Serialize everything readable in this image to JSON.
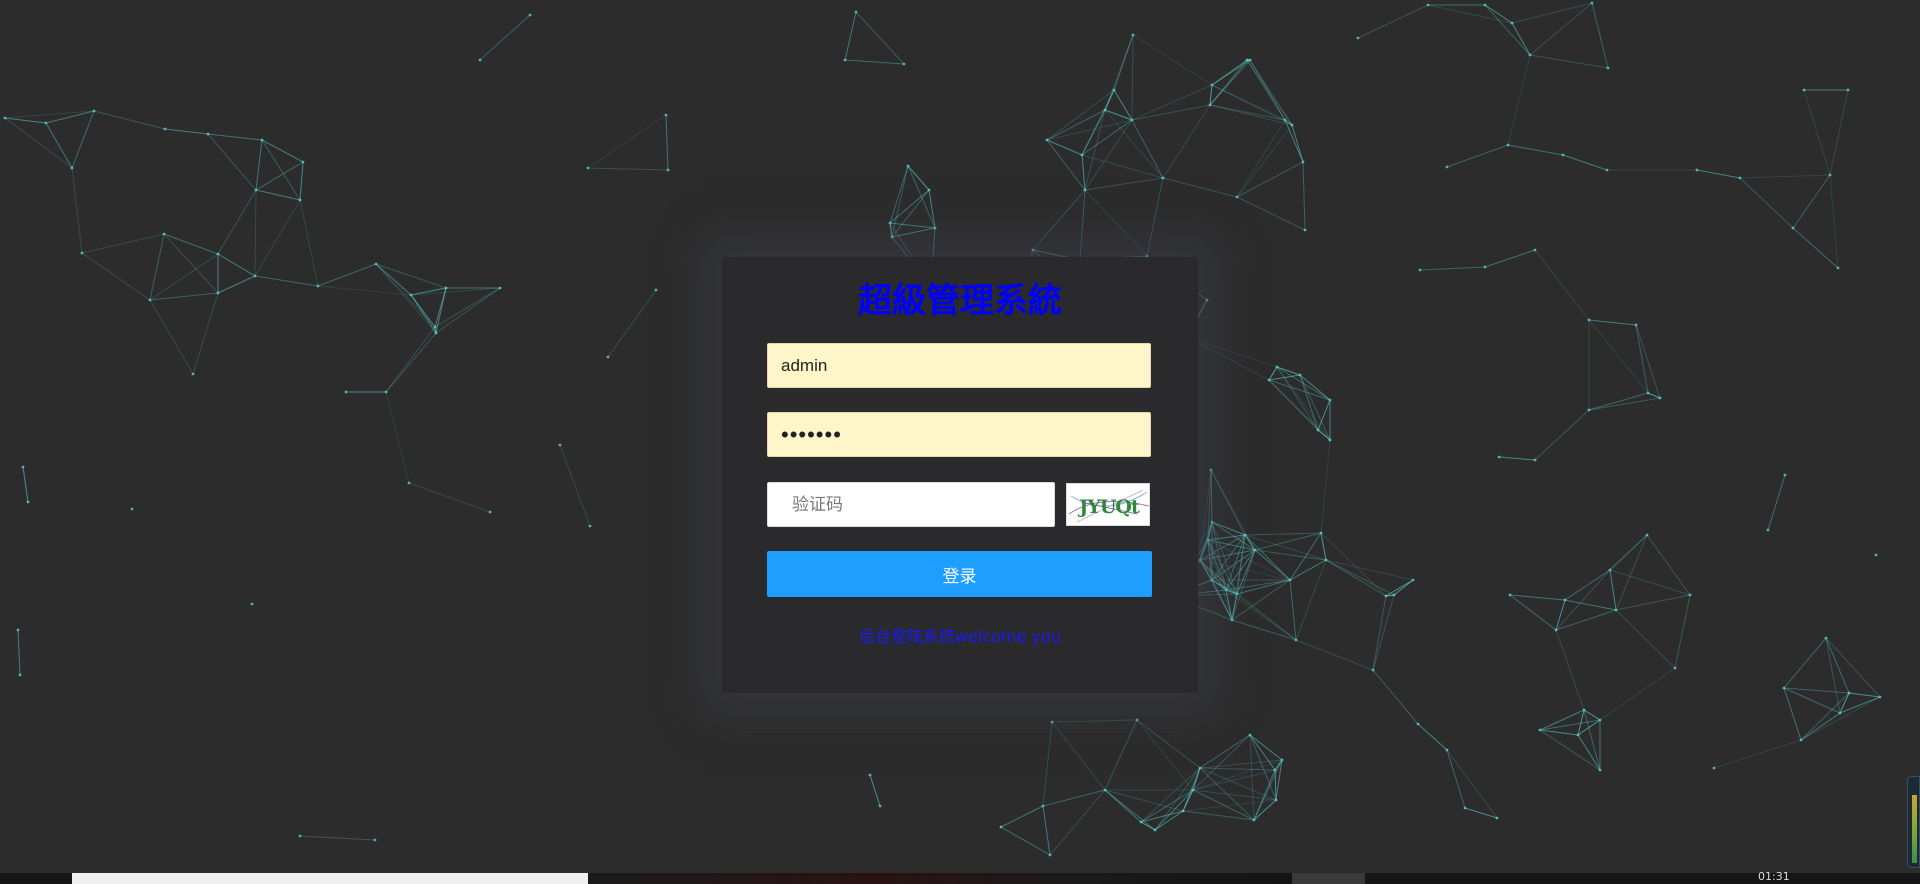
{
  "login": {
    "title": "超級管理系統",
    "username_value": "admin",
    "password_value": "•••••••",
    "captcha_placeholder": "验证码",
    "captcha_image_text": "JYUQt",
    "login_label": "登录",
    "welcome_text": "后台登陆系统welcome you"
  },
  "taskbar": {
    "clock_text": "01:31"
  },
  "colors": {
    "background": "#2c2c2c",
    "network_lines": "#5fcfcf",
    "title": "#0000ff",
    "login_button": "#1e9fff",
    "input_autofill": "#fef5c8"
  }
}
